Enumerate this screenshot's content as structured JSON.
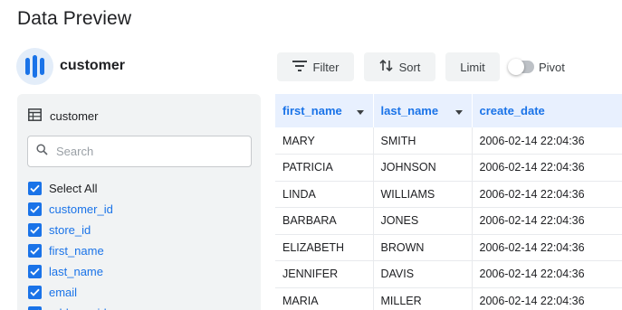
{
  "page": {
    "title": "Data Preview"
  },
  "dataset": {
    "name": "customer",
    "icon": "database-icon"
  },
  "toolbar": {
    "filter_label": "Filter",
    "sort_label": "Sort",
    "limit_label": "Limit",
    "pivot_label": "Pivot",
    "pivot_on": false
  },
  "columns_panel": {
    "table_name": "customer",
    "search_placeholder": "Search",
    "select_all_label": "Select All",
    "items": [
      {
        "label": "customer_id",
        "checked": true
      },
      {
        "label": "store_id",
        "checked": true
      },
      {
        "label": "first_name",
        "checked": true
      },
      {
        "label": "last_name",
        "checked": true
      },
      {
        "label": "email",
        "checked": true
      },
      {
        "label": "address_id",
        "checked": true
      }
    ]
  },
  "table": {
    "headers": [
      {
        "label": "first_name",
        "sortable": true
      },
      {
        "label": "last_name",
        "sortable": true
      },
      {
        "label": "create_date",
        "sortable": false
      }
    ],
    "rows": [
      [
        "MARY",
        "SMITH",
        "2006-02-14 22:04:36"
      ],
      [
        "PATRICIA",
        "JOHNSON",
        "2006-02-14 22:04:36"
      ],
      [
        "LINDA",
        "WILLIAMS",
        "2006-02-14 22:04:36"
      ],
      [
        "BARBARA",
        "JONES",
        "2006-02-14 22:04:36"
      ],
      [
        "ELIZABETH",
        "BROWN",
        "2006-02-14 22:04:36"
      ],
      [
        "JENNIFER",
        "DAVIS",
        "2006-02-14 22:04:36"
      ],
      [
        "MARIA",
        "MILLER",
        "2006-02-14 22:04:36"
      ]
    ]
  },
  "colors": {
    "accent": "#1a73e8",
    "header_bg": "#e8f0fe",
    "panel_bg": "#f1f3f4"
  }
}
